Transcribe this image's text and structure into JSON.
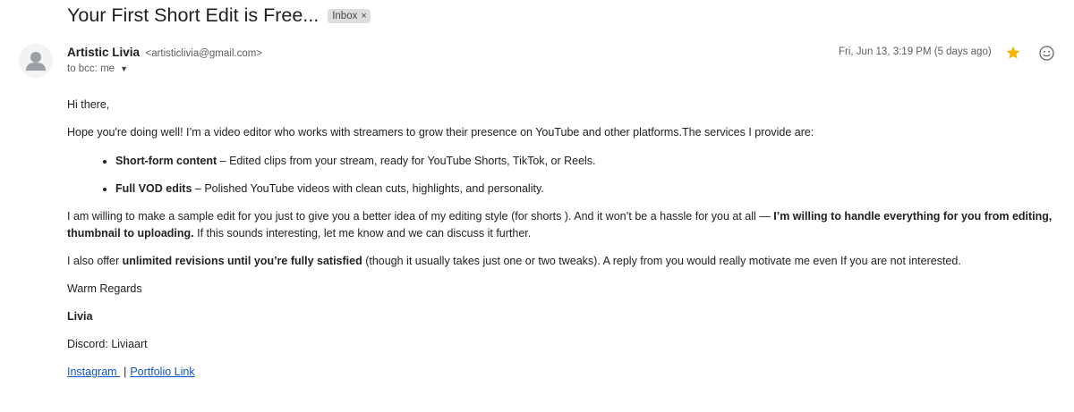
{
  "email": {
    "subject": "Your First Short Edit is Free...",
    "label": {
      "name": "Inbox",
      "remove_glyph": "×"
    },
    "sender": {
      "name": "Artistic Livia",
      "email": "<artisticlivia@gmail.com>",
      "to_text": "to bcc: me",
      "avatar_icon": "person-icon"
    },
    "date_text": "Fri, Jun 13, 3:19 PM (5 days ago)",
    "star_color": "#f4b400",
    "body": {
      "greeting": "Hi there,",
      "intro": "Hope you're doing well! I’m a video editor who works with streamers to grow their presence on YouTube and other platforms.The services I provide are:",
      "services": [
        {
          "title": "Short-form content",
          "desc": " – Edited clips from your stream, ready for YouTube Shorts, TikTok, or Reels."
        },
        {
          "title": "Full VOD edits",
          "desc": " – Polished YouTube videos with clean cuts, highlights, and personality."
        }
      ],
      "sample": {
        "text1": "I am willing to make a sample edit for you just to give you a better idea of my editing style (for shorts ). And it won’t be a hassle for you at all — ",
        "bold": "I’m willing to handle everything for you from editing, thumbnail to uploading.",
        "text2": " If this sounds interesting, let me know and we can discuss it further."
      },
      "offer": {
        "text1": "I also offer ",
        "bold": "unlimited revisions until you’re fully satisfied",
        "text2": " (though it usually takes just one or two tweaks). A reply from you would really motivate me even If you are not interested."
      },
      "regards": "Warm Regards",
      "name": "Livia",
      "discord": "Discord: Liviaart",
      "links": {
        "instagram": "Instagram ",
        "separator": "|",
        "portfolio": "Portfolio Link"
      }
    }
  }
}
